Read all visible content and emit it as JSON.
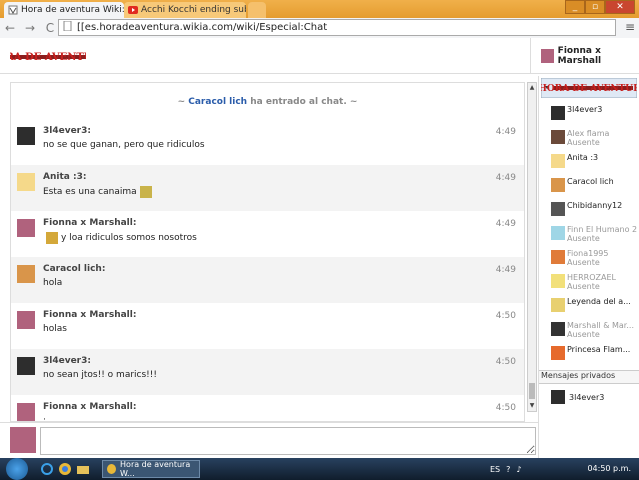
{
  "browser": {
    "tabs": [
      {
        "title": "Hora de aventura Wiki: Bi",
        "favicon": "wiki-icon",
        "close": "×"
      },
      {
        "title": "Acchi Kocchi ending sub",
        "favicon": "youtube-icon",
        "close": "×"
      }
    ],
    "window_controls": {
      "minimize": "_",
      "maximize": "▫",
      "close": "✕"
    },
    "url": "[[es.horadeaventura.wikia.com/wiki/Especial:Chat",
    "back": "←",
    "forward": "→",
    "reload": "C",
    "menu": "≡"
  },
  "header": {
    "logo_text": "HORA DE AVENTURA",
    "current_user": "Fionna x Marshall"
  },
  "chat": {
    "inline_alert": {
      "prefix": "~ ",
      "who": "Caracol lich",
      "suffix": " ha entrado al chat. ~"
    },
    "messages": [
      {
        "user": "3l4ever3:",
        "text": "no se que ganan, pero que ridiculos",
        "time": "4:49",
        "avatar": "#2d2d2d"
      },
      {
        "user": "Anita :3:",
        "text": "Esta es una canaima",
        "time": "4:49",
        "avatar": "#f5d98a",
        "emoticon": true
      },
      {
        "user": "Fionna x Marshall:",
        "text": "y loa ridiculos somos nosotros",
        "time": "4:49",
        "avatar": "#b0627d",
        "emoticon": true
      },
      {
        "user": "Caracol lich:",
        "text": "hola",
        "time": "4:49",
        "avatar": "#d9954a"
      },
      {
        "user": "Fionna x Marshall:",
        "text": "holas",
        "time": "4:50",
        "avatar": "#b0627d"
      },
      {
        "user": "3l4ever3:",
        "text": "no sean jtos!! o marics!!!",
        "time": "4:50",
        "avatar": "#2d2d2d"
      },
      {
        "user": "Fionna x Marshall:",
        "text": ":_.",
        "time": "4:50",
        "avatar": "#b0627d"
      }
    ]
  },
  "sidebar": {
    "logo_text": "HORA DE AVENTURA",
    "users": [
      {
        "name": "3l4ever3",
        "status": "",
        "away": false,
        "avatar": "#2d2d2d"
      },
      {
        "name": "Alex flama",
        "status": "Ausente",
        "away": true,
        "avatar": "#6b4a3a"
      },
      {
        "name": "Anita :3",
        "status": "",
        "away": false,
        "avatar": "#f5d98a"
      },
      {
        "name": "Caracol lich",
        "status": "",
        "away": false,
        "avatar": "#d9954a"
      },
      {
        "name": "Chibidanny12",
        "status": "",
        "away": false,
        "avatar": "#555"
      },
      {
        "name": "Finn El Humano 2",
        "status": "Ausente",
        "away": true,
        "avatar": "#9fd6e6"
      },
      {
        "name": "Fiona1995",
        "status": "Ausente",
        "away": true,
        "avatar": "#e07b39"
      },
      {
        "name": "HERROZAEL",
        "status": "Ausente",
        "away": true,
        "avatar": "#f2e07a"
      },
      {
        "name": "Leyenda del a...",
        "status": "",
        "away": false,
        "avatar": "#e8d070"
      },
      {
        "name": "Marshall & Mar...",
        "status": "Ausente",
        "away": true,
        "avatar": "#333"
      },
      {
        "name": "Princesa Flam...",
        "status": "",
        "away": false,
        "avatar": "#e66a2c"
      }
    ],
    "pm_header": "Mensajes privados",
    "pm_users": [
      {
        "name": "3l4ever3",
        "avatar": "#2d2d2d"
      }
    ]
  },
  "input": {
    "placeholder": ""
  },
  "taskbar": {
    "app_title": "Hora de aventura W...",
    "language": "ES",
    "clock": "04:50 p.m."
  }
}
